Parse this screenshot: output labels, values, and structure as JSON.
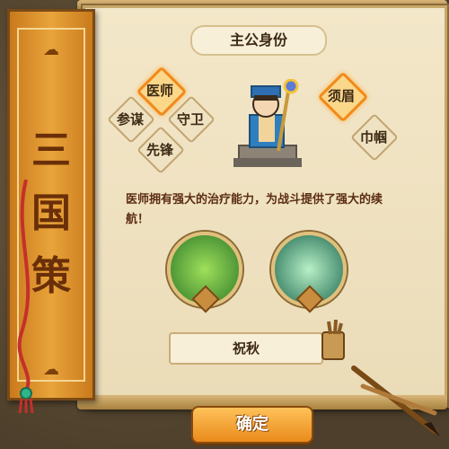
{
  "banner": {
    "title_chars": [
      "三",
      "国",
      "策"
    ]
  },
  "header": {
    "title": "主公身份"
  },
  "roles": {
    "doctor": "医师",
    "strategist": "参谋",
    "guard": "守卫",
    "vanguard": "先锋",
    "male": "须眉",
    "female": "巾帼"
  },
  "selected": {
    "profession": "医师",
    "gender": "须眉"
  },
  "description": "医师拥有强大的治疗能力，为战斗提供了强大的续航！",
  "player_name": "祝秋",
  "confirm_label": "确定",
  "colors": {
    "accent": "#f08a1c",
    "banner": "#e9a43b",
    "text": "#5c2d12"
  }
}
